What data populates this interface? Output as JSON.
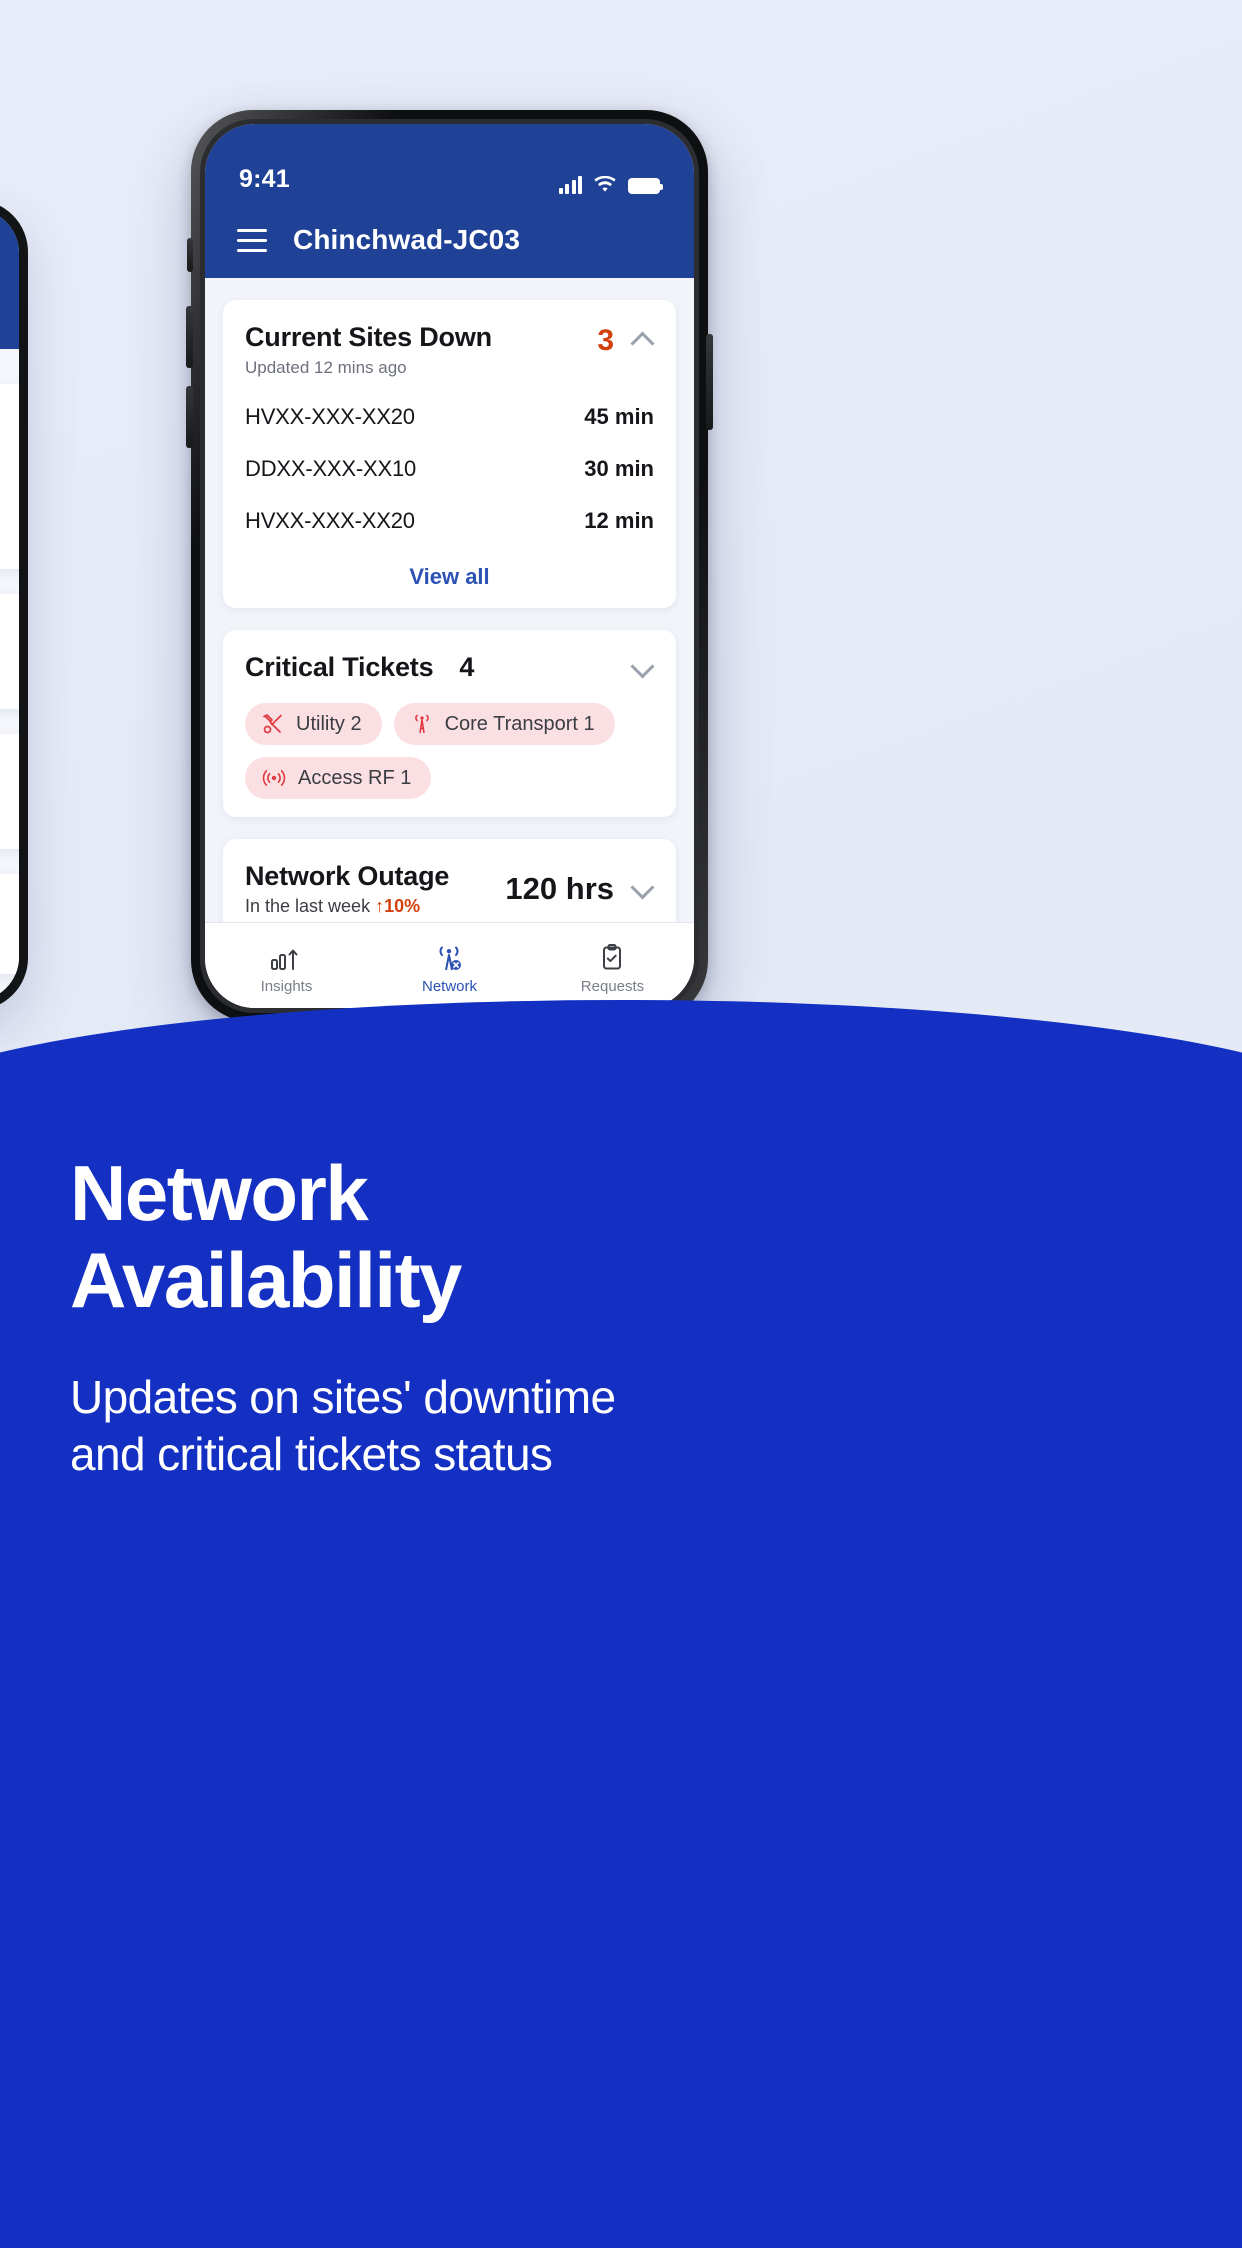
{
  "status_bar": {
    "time": "9:41",
    "signal_icon": "signal-bars-icon",
    "wifi_icon": "wifi-icon",
    "battery_icon": "battery-icon"
  },
  "app_bar": {
    "menu_icon": "hamburger-menu-icon",
    "title": "Chinchwad-JC03"
  },
  "cards": {
    "sites_down": {
      "title": "Current Sites Down",
      "subtitle": "Updated 12 mins ago",
      "count": "3",
      "collapse_icon": "chevron-up-icon",
      "rows": [
        {
          "name": "HVXX-XXX-XX20",
          "duration": "45 min"
        },
        {
          "name": "DDXX-XXX-XX10",
          "duration": "30 min"
        },
        {
          "name": "HVXX-XXX-XX20",
          "duration": "12 min"
        }
      ],
      "view_all_label": "View all"
    },
    "critical_tickets": {
      "title": "Critical Tickets",
      "count": "4",
      "expand_icon": "chevron-down-icon",
      "chips": [
        {
          "label": "Utility 2",
          "icon": "wrench-screwdriver-icon"
        },
        {
          "label": "Core Transport 1",
          "icon": "transport-tower-icon"
        },
        {
          "label": "Access RF 1",
          "icon": "rf-signal-icon"
        }
      ]
    },
    "network_outage": {
      "title": "Network Outage",
      "subtitle_text": "In the last week",
      "trend_arrow": "↑",
      "trend_value": "10%",
      "value": "120 hrs",
      "expand_icon": "chevron-down-icon"
    }
  },
  "bottom_nav": [
    {
      "label": "Insights",
      "icon": "bar-chart-up-icon",
      "active": false
    },
    {
      "label": "Network",
      "icon": "network-tower-alert-icon",
      "active": true
    },
    {
      "label": "Requests",
      "icon": "clipboard-check-icon",
      "active": false
    }
  ],
  "promo": {
    "headline_line1": "Network",
    "headline_line2": "Availability",
    "subline_line1": "Updates on sites' downtime",
    "subline_line2": "and critical tickets status"
  },
  "colors": {
    "brand_blue": "#1f4196",
    "panel_blue": "#1430c2",
    "accent_red": "#d2410c",
    "chip_bg": "#fbe0e3",
    "chip_icon": "#e0393f",
    "link_blue": "#2c52b3",
    "page_bg": "#e8ecf8"
  }
}
